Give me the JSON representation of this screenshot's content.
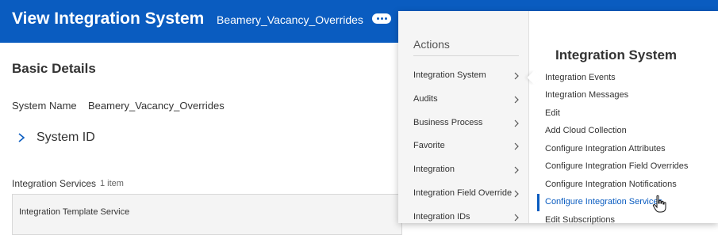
{
  "header": {
    "title": "View Integration System",
    "subtitle": "Beamery_Vacancy_Overrides",
    "more_icon": "more-dots-icon",
    "background": "#0a5cc0"
  },
  "basic_details": {
    "section_title": "Basic Details",
    "system_name_label": "System Name",
    "system_name_value": "Beamery_Vacancy_Overrides",
    "system_id_label": "System ID",
    "services_label": "Integration Services",
    "services_count": "1 item",
    "table_first_cell": "Integration Template Service"
  },
  "actions_menu": {
    "title": "Actions",
    "categories": [
      {
        "label": "Integration System"
      },
      {
        "label": "Audits"
      },
      {
        "label": "Business Process"
      },
      {
        "label": "Favorite"
      },
      {
        "label": "Integration"
      },
      {
        "label": "Integration Field Override"
      },
      {
        "label": "Integration IDs"
      }
    ],
    "submenu": {
      "title": "Integration System",
      "items": [
        {
          "label": "Integration Events"
        },
        {
          "label": "Integration Messages"
        },
        {
          "label": "Edit"
        },
        {
          "label": "Add Cloud Collection"
        },
        {
          "label": "Configure Integration Attributes"
        },
        {
          "label": "Configure Integration Field Overrides"
        },
        {
          "label": "Configure Integration Notifications"
        },
        {
          "label": "Configure Integration Services"
        },
        {
          "label": "Edit Subscriptions"
        }
      ],
      "active_item": "Configure Integration Services"
    }
  },
  "colors": {
    "accent": "#0a5cc0",
    "menu_left_bg": "#f5f5f5"
  }
}
